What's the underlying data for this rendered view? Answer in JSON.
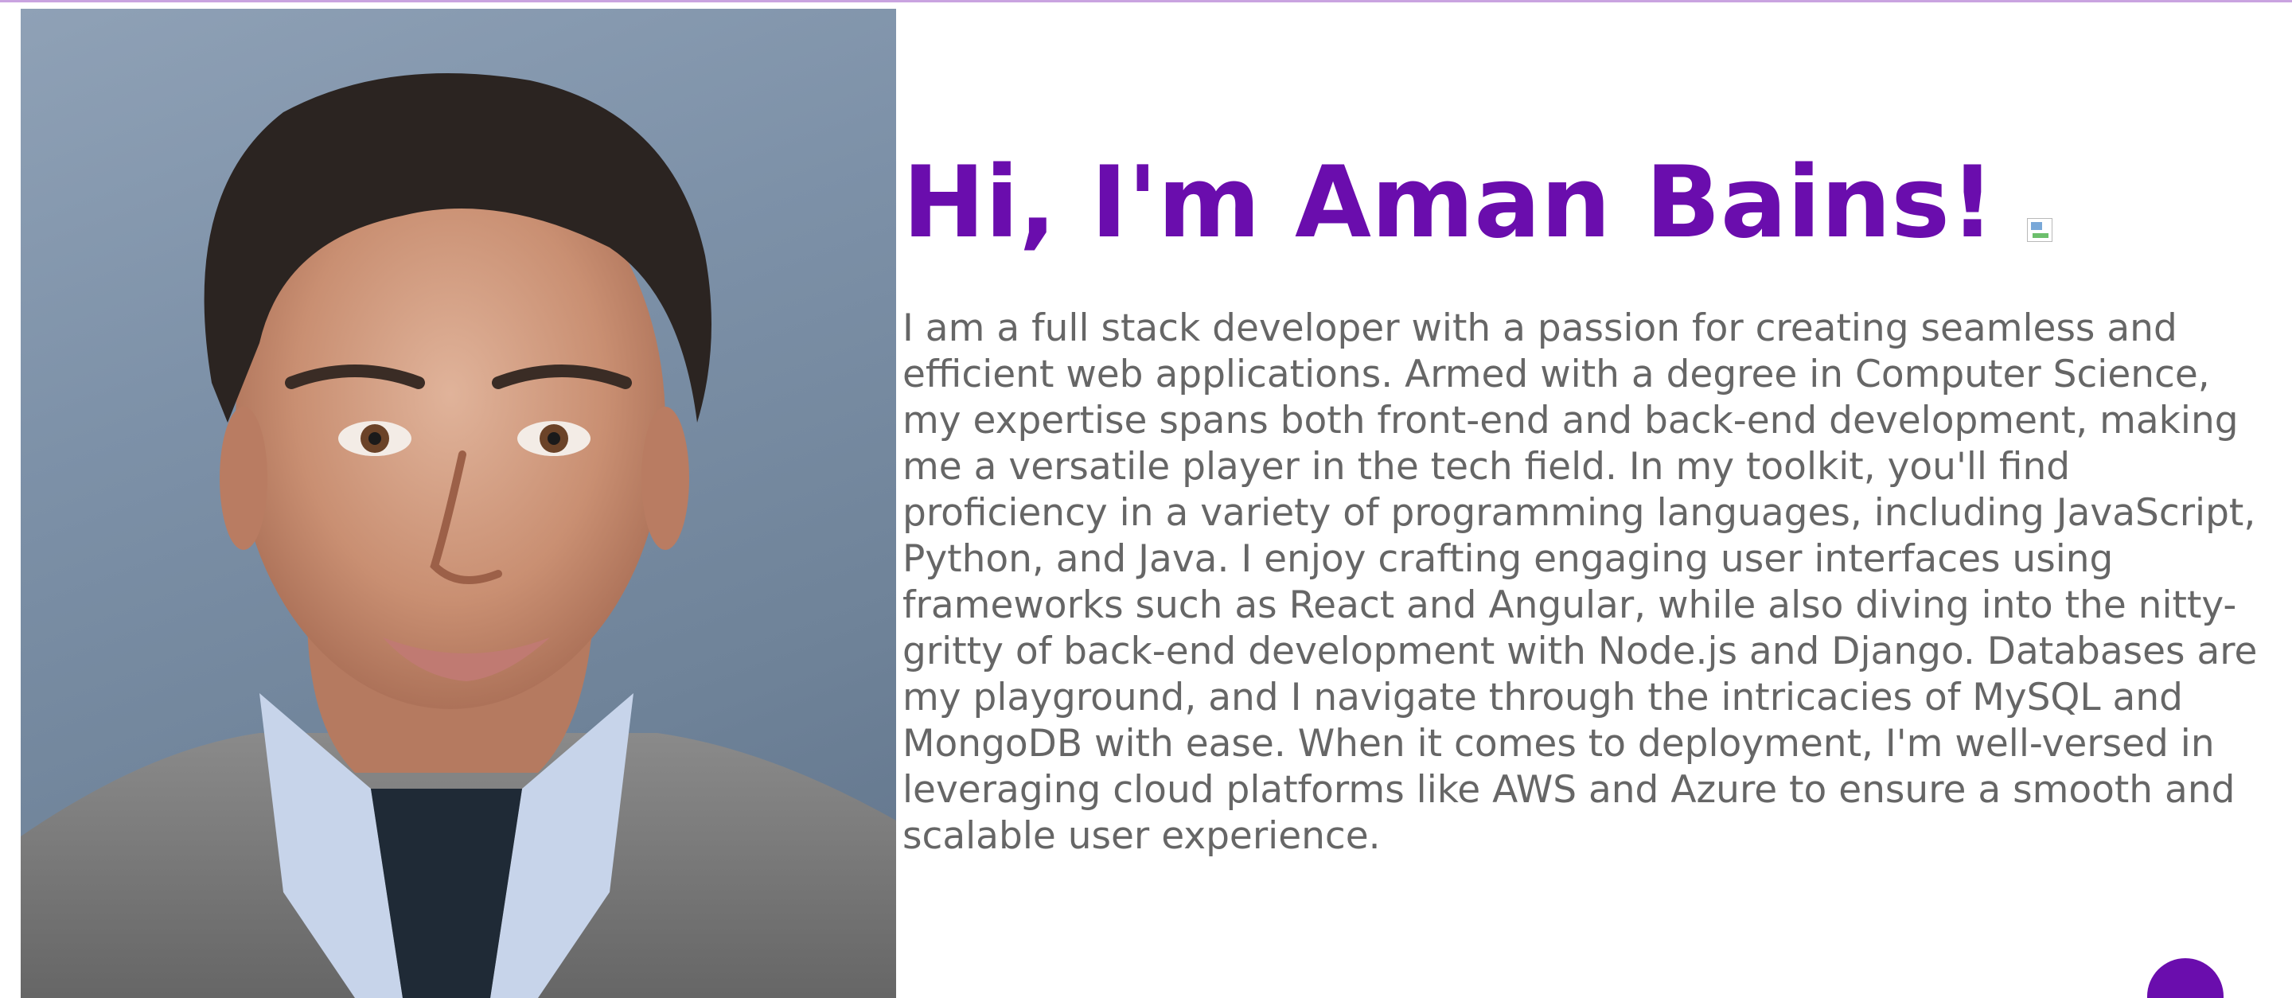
{
  "hero": {
    "title": "Hi, I'm Aman Bains!",
    "bio": "I am a full stack developer with a passion for creating seamless and efficient web applications. Armed with a degree in Computer Science, my expertise spans both front-end and back-end development, making me a versatile player in the tech field. In my toolkit, you'll find proficiency in a variety of programming languages, including JavaScript, Python, and Java. I enjoy crafting engaging user interfaces using frameworks such as React and Angular, while also diving into the nitty-gritty of back-end development with Node.js and Django. Databases are my playground, and I navigate through the intricacies of MySQL and MongoDB with ease. When it comes to deployment, I'm well-versed in leveraging cloud platforms like AWS and Azure to ensure a smooth and scalable user experience."
  },
  "colors": {
    "accent": "#6a0dad",
    "body_text": "#666666",
    "background": "#ffffff"
  },
  "icons": {
    "broken_image": "broken-image-icon",
    "floating_button": "floating-action-button"
  }
}
